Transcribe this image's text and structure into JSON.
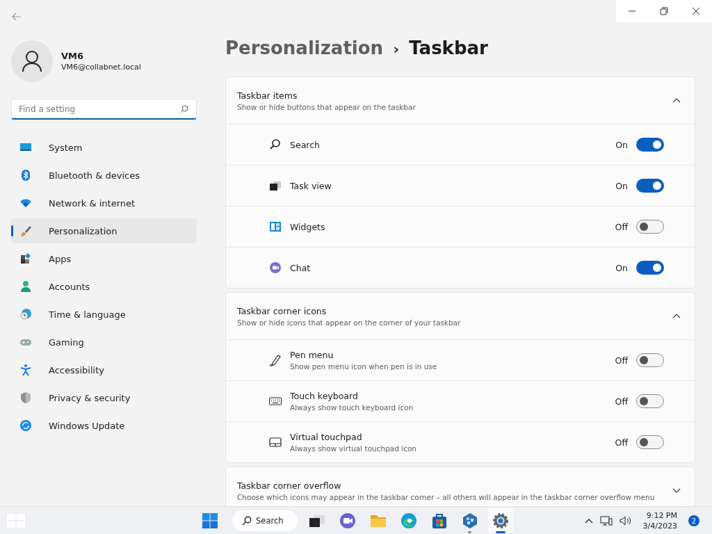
{
  "user": {
    "name": "VM6",
    "email": "VM6@collabnet.local"
  },
  "search": {
    "placeholder": "Find a setting"
  },
  "nav": [
    {
      "label": "System",
      "kind": "system",
      "selected": false
    },
    {
      "label": "Bluetooth & devices",
      "kind": "bluetooth",
      "selected": false
    },
    {
      "label": "Network & internet",
      "kind": "network",
      "selected": false
    },
    {
      "label": "Personalization",
      "kind": "personalization",
      "selected": true
    },
    {
      "label": "Apps",
      "kind": "apps",
      "selected": false
    },
    {
      "label": "Accounts",
      "kind": "accounts",
      "selected": false
    },
    {
      "label": "Time & language",
      "kind": "time",
      "selected": false
    },
    {
      "label": "Gaming",
      "kind": "gaming",
      "selected": false
    },
    {
      "label": "Accessibility",
      "kind": "accessibility",
      "selected": false
    },
    {
      "label": "Privacy & security",
      "kind": "privacy",
      "selected": false
    },
    {
      "label": "Windows Update",
      "kind": "update",
      "selected": false
    }
  ],
  "breadcrumb": {
    "parent": "Personalization",
    "separator": "›",
    "current": "Taskbar"
  },
  "sections": [
    {
      "title": "Taskbar items",
      "subtitle": "Show or hide buttons that appear on the taskbar",
      "expanded": true,
      "items": [
        {
          "label": "Search",
          "kind": "search",
          "on": true,
          "state_label": "On"
        },
        {
          "label": "Task view",
          "kind": "taskview",
          "on": true,
          "state_label": "On"
        },
        {
          "label": "Widgets",
          "kind": "widgets",
          "on": false,
          "state_label": "Off"
        },
        {
          "label": "Chat",
          "kind": "chat",
          "on": true,
          "state_label": "On"
        }
      ]
    },
    {
      "title": "Taskbar corner icons",
      "subtitle": "Show or hide icons that appear on the corner of your taskbar",
      "expanded": true,
      "items": [
        {
          "label": "Pen menu",
          "description": "Show pen menu icon when pen is in use",
          "kind": "pen",
          "on": false,
          "state_label": "Off"
        },
        {
          "label": "Touch keyboard",
          "description": "Always show touch keyboard icon",
          "kind": "keyboard",
          "on": false,
          "state_label": "Off"
        },
        {
          "label": "Virtual touchpad",
          "description": "Always show virtual touchpad icon",
          "kind": "touchpad",
          "on": false,
          "state_label": "Off"
        }
      ]
    },
    {
      "title": "Taskbar corner overflow",
      "subtitle": "Choose which icons may appear in the taskbar corner – all others will appear in the taskbar corner overflow menu",
      "expanded": false
    }
  ],
  "taskbar": {
    "search_label": "Search",
    "apps": [
      {
        "kind": "taskview",
        "running": false,
        "selected": false
      },
      {
        "kind": "chat",
        "running": false,
        "selected": false
      },
      {
        "kind": "explorer",
        "running": false,
        "selected": false
      },
      {
        "kind": "edge",
        "running": false,
        "selected": false
      },
      {
        "kind": "store",
        "running": false,
        "selected": false
      },
      {
        "kind": "app",
        "running": true,
        "selected": false
      },
      {
        "kind": "settings",
        "running": true,
        "selected": true
      }
    ],
    "time": "9:12 PM",
    "date": "3/4/2023",
    "notifications": "2"
  }
}
